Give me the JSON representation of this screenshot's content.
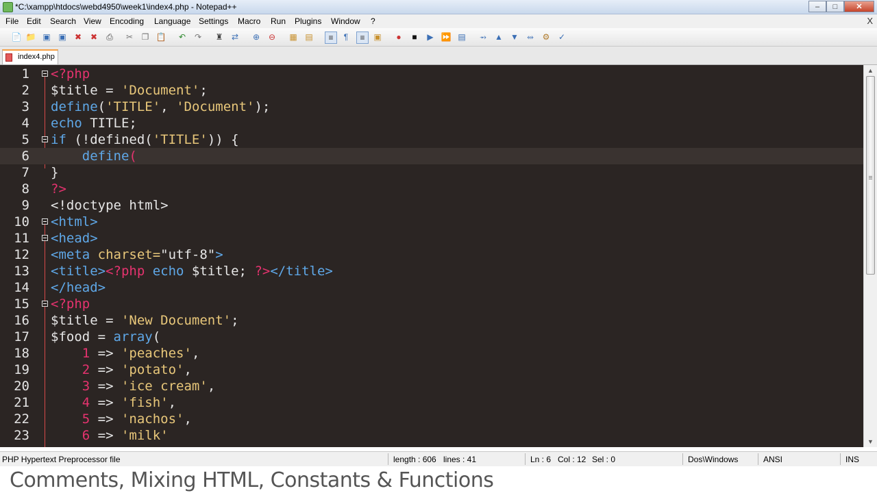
{
  "window": {
    "title": "*C:\\xampp\\htdocs\\webd4950\\week1\\index4.php - Notepad++",
    "menu_close": "X"
  },
  "menu": [
    "File",
    "Edit",
    "Search",
    "View",
    "Encoding",
    "Language",
    "Settings",
    "Macro",
    "Run",
    "Plugins",
    "Window",
    "?"
  ],
  "tab": {
    "label": "index4.php"
  },
  "colors": {
    "editor_bg": "#2b2523",
    "keyword": "#5fa8e8",
    "string": "#e8c77a",
    "php_tag": "#e6336f",
    "number": "#e6336f",
    "text": "#e6e6e6"
  },
  "code_lines": [
    {
      "n": "1",
      "tokens": [
        {
          "t": "<?php",
          "c": "#e6336f"
        }
      ]
    },
    {
      "n": "2",
      "tokens": [
        {
          "t": "$title = ",
          "c": "#e6e6e6"
        },
        {
          "t": "'Document'",
          "c": "#e8c77a"
        },
        {
          "t": ";",
          "c": "#e6e6e6"
        }
      ]
    },
    {
      "n": "3",
      "tokens": [
        {
          "t": "define",
          "c": "#5fa8e8"
        },
        {
          "t": "(",
          "c": "#e6e6e6"
        },
        {
          "t": "'TITLE'",
          "c": "#e8c77a"
        },
        {
          "t": ", ",
          "c": "#e6e6e6"
        },
        {
          "t": "'Document'",
          "c": "#e8c77a"
        },
        {
          "t": ");",
          "c": "#e6e6e6"
        }
      ]
    },
    {
      "n": "4",
      "tokens": [
        {
          "t": "echo",
          "c": "#5fa8e8"
        },
        {
          "t": " TITLE;",
          "c": "#e6e6e6"
        }
      ]
    },
    {
      "n": "5",
      "tokens": [
        {
          "t": "if",
          "c": "#5fa8e8"
        },
        {
          "t": " (!defined(",
          "c": "#e6e6e6"
        },
        {
          "t": "'TITLE'",
          "c": "#e8c77a"
        },
        {
          "t": ")) {",
          "c": "#e6e6e6"
        }
      ]
    },
    {
      "n": "6",
      "tokens": [
        {
          "t": "    define",
          "c": "#5fa8e8"
        },
        {
          "t": "(",
          "c": "#e6336f"
        }
      ]
    },
    {
      "n": "7",
      "tokens": [
        {
          "t": "}",
          "c": "#e6e6e6"
        }
      ]
    },
    {
      "n": "8",
      "tokens": [
        {
          "t": "?>",
          "c": "#e6336f"
        }
      ]
    },
    {
      "n": "9",
      "tokens": [
        {
          "t": "<!doctype html>",
          "c": "#e6e6e6"
        }
      ]
    },
    {
      "n": "10",
      "tokens": [
        {
          "t": "<html>",
          "c": "#5fa8e8"
        }
      ]
    },
    {
      "n": "11",
      "tokens": [
        {
          "t": "<head>",
          "c": "#5fa8e8"
        }
      ]
    },
    {
      "n": "12",
      "tokens": [
        {
          "t": "<meta ",
          "c": "#5fa8e8"
        },
        {
          "t": "charset=",
          "c": "#e8c77a"
        },
        {
          "t": "\"utf-8\"",
          "c": "#e6e6e6"
        },
        {
          "t": ">",
          "c": "#5fa8e8"
        }
      ]
    },
    {
      "n": "13",
      "tokens": [
        {
          "t": "<title>",
          "c": "#5fa8e8"
        },
        {
          "t": "<?php ",
          "c": "#e6336f"
        },
        {
          "t": "echo",
          "c": "#5fa8e8"
        },
        {
          "t": " $title; ",
          "c": "#e6e6e6"
        },
        {
          "t": "?>",
          "c": "#e6336f"
        },
        {
          "t": "</title>",
          "c": "#5fa8e8"
        }
      ]
    },
    {
      "n": "14",
      "tokens": [
        {
          "t": "</head>",
          "c": "#5fa8e8"
        }
      ]
    },
    {
      "n": "15",
      "tokens": [
        {
          "t": "<?php",
          "c": "#e6336f"
        }
      ]
    },
    {
      "n": "16",
      "tokens": [
        {
          "t": "$title = ",
          "c": "#e6e6e6"
        },
        {
          "t": "'New Document'",
          "c": "#e8c77a"
        },
        {
          "t": ";",
          "c": "#e6e6e6"
        }
      ]
    },
    {
      "n": "17",
      "tokens": [
        {
          "t": "$food = ",
          "c": "#e6e6e6"
        },
        {
          "t": "array",
          "c": "#5fa8e8"
        },
        {
          "t": "(",
          "c": "#e6e6e6"
        }
      ]
    },
    {
      "n": "18",
      "tokens": [
        {
          "t": "    ",
          "c": "#e6e6e6"
        },
        {
          "t": "1",
          "c": "#e6336f"
        },
        {
          "t": " => ",
          "c": "#e6e6e6"
        },
        {
          "t": "'peaches'",
          "c": "#e8c77a"
        },
        {
          "t": ",",
          "c": "#e6e6e6"
        }
      ]
    },
    {
      "n": "19",
      "tokens": [
        {
          "t": "    ",
          "c": "#e6e6e6"
        },
        {
          "t": "2",
          "c": "#e6336f"
        },
        {
          "t": " => ",
          "c": "#e6e6e6"
        },
        {
          "t": "'potato'",
          "c": "#e8c77a"
        },
        {
          "t": ",",
          "c": "#e6e6e6"
        }
      ]
    },
    {
      "n": "20",
      "tokens": [
        {
          "t": "    ",
          "c": "#e6e6e6"
        },
        {
          "t": "3",
          "c": "#e6336f"
        },
        {
          "t": " => ",
          "c": "#e6e6e6"
        },
        {
          "t": "'ice cream'",
          "c": "#e8c77a"
        },
        {
          "t": ",",
          "c": "#e6e6e6"
        }
      ]
    },
    {
      "n": "21",
      "tokens": [
        {
          "t": "    ",
          "c": "#e6e6e6"
        },
        {
          "t": "4",
          "c": "#e6336f"
        },
        {
          "t": " => ",
          "c": "#e6e6e6"
        },
        {
          "t": "'fish'",
          "c": "#e8c77a"
        },
        {
          "t": ",",
          "c": "#e6e6e6"
        }
      ]
    },
    {
      "n": "22",
      "tokens": [
        {
          "t": "    ",
          "c": "#e6e6e6"
        },
        {
          "t": "5",
          "c": "#e6336f"
        },
        {
          "t": " => ",
          "c": "#e6e6e6"
        },
        {
          "t": "'nachos'",
          "c": "#e8c77a"
        },
        {
          "t": ",",
          "c": "#e6e6e6"
        }
      ]
    },
    {
      "n": "23",
      "tokens": [
        {
          "t": "    ",
          "c": "#e6e6e6"
        },
        {
          "t": "6",
          "c": "#e6336f"
        },
        {
          "t": " => ",
          "c": "#e6e6e6"
        },
        {
          "t": "'milk'",
          "c": "#e8c77a"
        }
      ]
    }
  ],
  "current_line": "6",
  "status": {
    "file_type": "PHP Hypertext Preprocessor file",
    "length": "length : 606",
    "lines": "lines : 41",
    "ln": "Ln : 6",
    "col": "Col : 12",
    "sel": "Sel : 0",
    "eol": "Dos\\Windows",
    "encoding": "ANSI",
    "mode": "INS"
  },
  "caption": "Comments, Mixing HTML, Constants & Functions"
}
